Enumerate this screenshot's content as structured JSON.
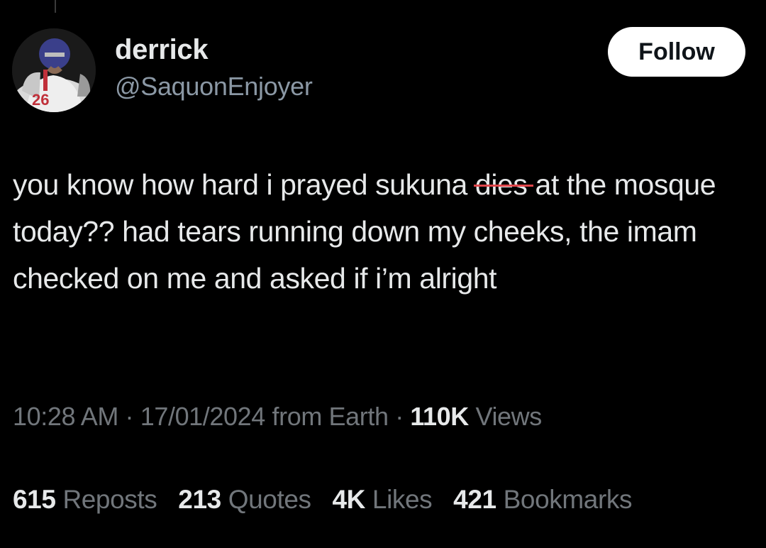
{
  "author": {
    "display_name": "derrick",
    "handle": "@SaquonEnjoyer",
    "avatar_jersey_number": "26"
  },
  "follow_button": {
    "label": "Follow"
  },
  "tweet": {
    "text_before_strike": "you know how hard i prayed sukuna ",
    "struck_word": "dies",
    "text_after_strike": " at the mosque today??  had tears running down my cheeks, the imam checked on me and asked if i’m alright",
    "strike_color": "#e0464b"
  },
  "meta": {
    "time": "10:28 AM",
    "date": "17/01/2024",
    "source": "from Earth",
    "separator": "·",
    "views_count": "110K",
    "views_label": "Views"
  },
  "stats": [
    {
      "count": "615",
      "label": "Reposts"
    },
    {
      "count": "213",
      "label": "Quotes"
    },
    {
      "count": "4K",
      "label": "Likes"
    },
    {
      "count": "421",
      "label": "Bookmarks"
    }
  ],
  "colors": {
    "background": "#000000",
    "primary_text": "#e7e9ea",
    "secondary_text": "#71767b",
    "follow_bg": "#ffffff"
  }
}
